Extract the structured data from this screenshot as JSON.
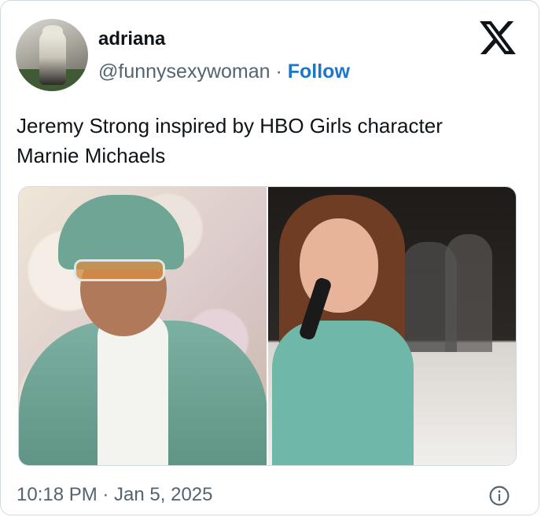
{
  "author": {
    "name": "adriana",
    "handle": "@funnysexywoman",
    "separator": " · ",
    "follow_label": "Follow"
  },
  "tweet": {
    "text_line1": "Jeremy Strong inspired by HBO Girls character",
    "text_line2": "Marnie Michaels"
  },
  "footer": {
    "timestamp": "10:18 PM · Jan 5, 2025"
  },
  "icons": {
    "brand": "x-logo-icon",
    "info": "info-icon"
  },
  "colors": {
    "follow": "#1d76c8",
    "secondary_text": "#536471",
    "border": "#cfd9de"
  }
}
